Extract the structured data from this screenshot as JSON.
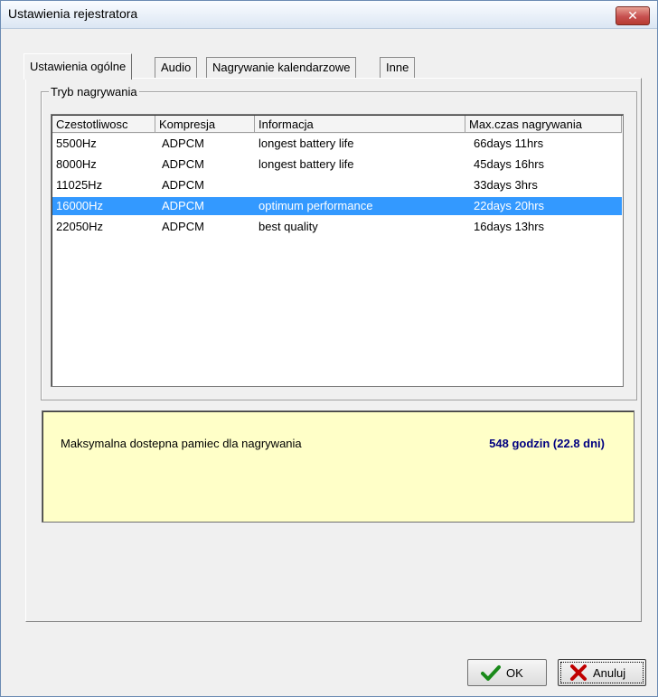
{
  "window": {
    "title": "Ustawienia rejestratora",
    "close_glyph": "✕"
  },
  "tabs": [
    {
      "label": "Ustawienia ogólne",
      "active": true
    },
    {
      "label": "Audio",
      "active": false
    },
    {
      "label": "Nagrywanie kalendarzowe",
      "active": false
    },
    {
      "label": "Inne",
      "active": false
    }
  ],
  "group": {
    "label": "Tryb nagrywania"
  },
  "table": {
    "columns": [
      "Czestotliwosc",
      "Kompresja",
      "Informacja",
      "Max.czas nagrywania"
    ],
    "rows": [
      [
        "5500Hz",
        "ADPCM",
        "longest battery life",
        "66days  11hrs"
      ],
      [
        "8000Hz",
        "ADPCM",
        "longest battery life",
        "45days  16hrs"
      ],
      [
        "11025Hz",
        "ADPCM",
        "",
        "33days  3hrs"
      ],
      [
        "16000Hz",
        "ADPCM",
        "optimum performance",
        "22days  20hrs"
      ],
      [
        "22050Hz",
        "ADPCM",
        "best quality",
        "16days  13hrs"
      ]
    ],
    "selected_row": 3
  },
  "info": {
    "label": "Maksymalna dostepna pamiec dla nagrywania",
    "value": "548 godzin (22.8 dni)"
  },
  "buttons": {
    "ok_label": "OK",
    "cancel_label": "Anuluj"
  },
  "icons": {
    "ok_icon": "checkmark-icon",
    "cancel_icon": "x-mark-icon"
  },
  "colors": {
    "selection": "#3399ff",
    "info_background": "#ffffc8",
    "info_value": "#000080",
    "close_button": "#c75050"
  }
}
